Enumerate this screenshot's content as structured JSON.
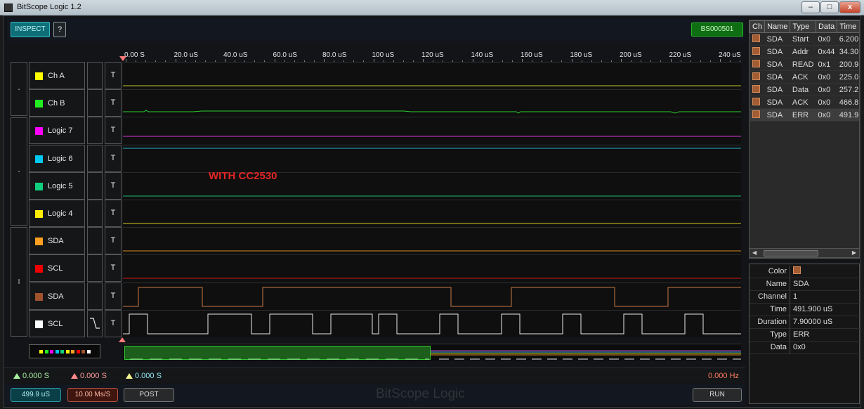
{
  "window": {
    "title": "BitScope Logic 1.2",
    "min": "–",
    "max": "□",
    "close": "x"
  },
  "toolbar": {
    "inspect_label": "INSPECT",
    "help_label": "?",
    "device_id": "BS000501"
  },
  "ruler": {
    "labels": [
      "0.00  S",
      "20.0 uS",
      "40.0 uS",
      "60.0 uS",
      "80.0 uS",
      "100 uS",
      "120 uS",
      "140 uS",
      "160 uS",
      "180 uS",
      "200 uS",
      "220 uS",
      "240 uS"
    ]
  },
  "groups": [
    "-",
    "-",
    "I"
  ],
  "channels": [
    {
      "name": "Ch A",
      "color": "#ffff00",
      "trigger": "T",
      "trace_color": "#c9c531",
      "edge": ""
    },
    {
      "name": "Ch B",
      "color": "#22ee22",
      "trigger": "T",
      "trace_color": "#2dcc2d",
      "edge": ""
    },
    {
      "name": "Logic 7",
      "color": "#ff00ff",
      "trigger": "T",
      "trace_color": "#d23cd2",
      "edge": ""
    },
    {
      "name": "Logic 6",
      "color": "#00c8f0",
      "trigger": "T",
      "trace_color": "#2bb3d2",
      "edge": ""
    },
    {
      "name": "Logic 5",
      "color": "#10d080",
      "trigger": "T",
      "trace_color": "#1fb474",
      "edge": ""
    },
    {
      "name": "Logic 4",
      "color": "#ffee00",
      "trigger": "T",
      "trace_color": "#d4c422",
      "edge": ""
    },
    {
      "name": "SDA",
      "color": "#ffa020",
      "trigger": "T",
      "trace_color": "#d08a20",
      "edge": ""
    },
    {
      "name": "SCL",
      "color": "#ee0000",
      "trigger": "T",
      "trace_color": "#d21818",
      "edge": ""
    },
    {
      "name": "SDA",
      "color": "#a0522d",
      "trigger": "T",
      "trace_color": "#c87a45",
      "edge": ""
    },
    {
      "name": "SCL",
      "color": "#ffffff",
      "trigger": "T",
      "trace_color": "#e8e8e8",
      "edge": "falling"
    }
  ],
  "annotation": "WITH CC2530",
  "cursors": {
    "a": "0.000  S",
    "b": "0.000  S",
    "delta": "0.000  S",
    "freq": "0.000  Hz"
  },
  "bottom": {
    "timebase": "499.9 uS",
    "samplerate": "10.00 Ms/S",
    "post_label": "POST",
    "run_label": "RUN",
    "watermark": "BitScope Logic"
  },
  "decode_table": {
    "headers": [
      "Ch",
      "Name",
      "Type",
      "Data",
      "Time"
    ],
    "rows": [
      {
        "name": "SDA",
        "type": "Start",
        "data": "0x0",
        "time": "6.200"
      },
      {
        "name": "SDA",
        "type": "Addr",
        "data": "0x44",
        "time": "34.30"
      },
      {
        "name": "SDA",
        "type": "READ",
        "data": "0x1",
        "time": "200.9"
      },
      {
        "name": "SDA",
        "type": "ACK",
        "data": "0x0",
        "time": "225.0"
      },
      {
        "name": "SDA",
        "type": "Data",
        "data": "0x0",
        "time": "257.2"
      },
      {
        "name": "SDA",
        "type": "ACK",
        "data": "0x0",
        "time": "466.8"
      },
      {
        "name": "SDA",
        "type": "ERR",
        "data": "0x0",
        "time": "491.9"
      }
    ],
    "selected_index": 6
  },
  "properties": {
    "Color": "",
    "Name": "SDA",
    "Channel": "1",
    "Time": "491.900 uS",
    "Duration": "7.90000 uS",
    "Type": "ERR",
    "Data": "0x0"
  },
  "colors": {
    "accent_teal": "#36b8c4",
    "device_green": "#28b82b",
    "sda_decode": "#a45c32"
  }
}
